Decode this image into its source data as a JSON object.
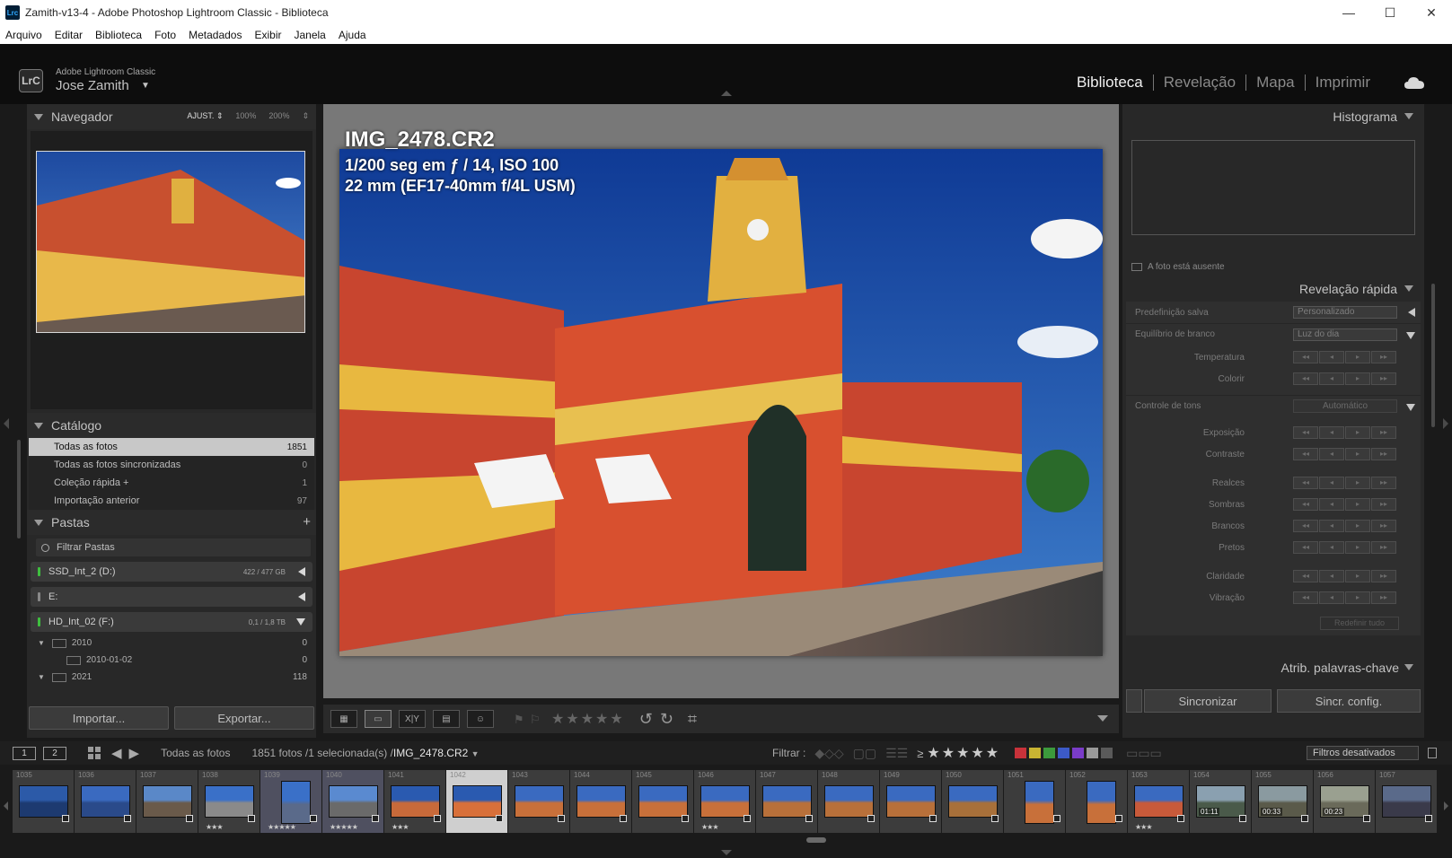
{
  "window": {
    "title": "Zamith-v13-4 - Adobe Photoshop Lightroom Classic - Biblioteca",
    "app_icon_text": "Lrc",
    "controls": [
      "—",
      "☐",
      "✕"
    ]
  },
  "menu": [
    "Arquivo",
    "Editar",
    "Biblioteca",
    "Foto",
    "Metadados",
    "Exibir",
    "Janela",
    "Ajuda"
  ],
  "identity": {
    "logo": "LrC",
    "product": "Adobe Lightroom Classic",
    "user": "Jose Zamith"
  },
  "modules": [
    {
      "label": "Biblioteca",
      "active": true
    },
    {
      "label": "Revelação",
      "active": false
    },
    {
      "label": "Mapa",
      "active": false
    },
    {
      "label": "Imprimir",
      "active": false
    }
  ],
  "navigator": {
    "title": "Navegador",
    "zoom": [
      "AJUST. ⇕",
      "100%",
      "200%",
      "⇕"
    ]
  },
  "catalog": {
    "title": "Catálogo",
    "items": [
      {
        "label": "Todas as fotos",
        "count": "1851",
        "selected": true
      },
      {
        "label": "Todas as fotos sincronizadas",
        "count": "0",
        "selected": false
      },
      {
        "label": "Coleção rápida  +",
        "count": "1",
        "selected": false
      },
      {
        "label": "Importação anterior",
        "count": "97",
        "selected": false
      }
    ]
  },
  "folders": {
    "title": "Pastas",
    "add": "+",
    "filter_placeholder": "Filtrar Pastas",
    "volumes": [
      {
        "name": "SSD_Int_2 (D:)",
        "info": "422 / 477 GB",
        "led": "green"
      },
      {
        "name": "E:",
        "info": "",
        "led": "gray"
      },
      {
        "name": "HD_Int_02 (F:)",
        "info": "0,1 / 1,8 TB",
        "led": "green"
      }
    ],
    "tree": [
      {
        "label": "2010",
        "count": "0"
      },
      {
        "label": "2010-01-02",
        "count": "0"
      },
      {
        "label": "2021",
        "count": "118"
      }
    ]
  },
  "left_buttons": {
    "import": "Importar...",
    "export": "Exportar..."
  },
  "loupe": {
    "filename": "IMG_2478.CR2",
    "exif1": "1/200 seg em ƒ / 14, ISO 100",
    "exif2": "22 mm (EF17-40mm f/4L USM)"
  },
  "histogram": {
    "title": "Histograma",
    "message": "A foto está ausente"
  },
  "quick_develop": {
    "title": "Revelação rápida",
    "saved_preset_label": "Predefinição salva",
    "saved_preset_value": "Personalizado",
    "wb_label": "Equilíbrio de branco",
    "wb_value": "Luz do dia",
    "temperature": "Temperatura",
    "tint": "Colorir",
    "tone_label": "Controle de tons",
    "auto": "Automático",
    "exposure": "Exposição",
    "contrast": "Contraste",
    "highlights": "Realces",
    "shadows": "Sombras",
    "whites": "Brancos",
    "blacks": "Pretos",
    "clarity": "Claridade",
    "vibrance": "Vibração",
    "reset_all": "Redefinir tudo",
    "stepper": [
      "◂◂",
      "◂",
      "▸",
      "▸▸"
    ]
  },
  "keywords": {
    "title": "Atrib. palavras-chave"
  },
  "sync": {
    "sync": "Sincronizar",
    "sync_settings": "Sincr. config."
  },
  "toolbar": {
    "grid_icon": "grid-view-icon",
    "stars": "★★★★★"
  },
  "filmstrip_header": {
    "monitor1": "1",
    "monitor2": "2",
    "source": "Todas as fotos",
    "count": "1851 fotos /1 selecionada(s) /",
    "current_file": "IMG_2478.CR2",
    "filter_label": "Filtrar :",
    "stars_prefix": "≥",
    "stars": "★★★★★",
    "filters_off": "Filtros desativados",
    "swatches": [
      "#c8323a",
      "#c8b432",
      "#3c9a3c",
      "#3c5ac8",
      "#7a3cc8",
      "#9a9a9a",
      "#5a5a5a"
    ]
  },
  "filmstrip": [
    {
      "num": "1035",
      "stars": "",
      "c1": "#2c5aa8",
      "c2": "#1d3a70",
      "kind": "land"
    },
    {
      "num": "1036",
      "stars": "",
      "c1": "#3a6ac0",
      "c2": "#2a4a8a",
      "kind": "land"
    },
    {
      "num": "1037",
      "stars": "",
      "c1": "#5a88c8",
      "c2": "#6a5a4a",
      "kind": "land"
    },
    {
      "num": "1038",
      "stars": "★★★",
      "c1": "#3a70c8",
      "c2": "#8a8a8a",
      "kind": "land"
    },
    {
      "num": "1039",
      "stars": "★★★★★",
      "c1": "#3a70c8",
      "c2": "#5a6a8a",
      "kind": "port",
      "picked": true
    },
    {
      "num": "1040",
      "stars": "★★★★★",
      "c1": "#5a8ad0",
      "c2": "#6a6a6a",
      "kind": "land",
      "picked": true
    },
    {
      "num": "1041",
      "stars": "★★★",
      "c1": "#2a5ab0",
      "c2": "#c86a3a",
      "kind": "land"
    },
    {
      "num": "1042",
      "stars": "",
      "c1": "#2a5ab0",
      "c2": "#d8703a",
      "kind": "land",
      "selected": true
    },
    {
      "num": "1043",
      "stars": "",
      "c1": "#3a6ac0",
      "c2": "#c8703a",
      "kind": "land"
    },
    {
      "num": "1044",
      "stars": "",
      "c1": "#3a6ac0",
      "c2": "#c8703a",
      "kind": "land"
    },
    {
      "num": "1045",
      "stars": "",
      "c1": "#3a6ac0",
      "c2": "#c8703a",
      "kind": "land"
    },
    {
      "num": "1046",
      "stars": "★★★",
      "c1": "#3a6ac0",
      "c2": "#c8703a",
      "kind": "land"
    },
    {
      "num": "1047",
      "stars": "",
      "c1": "#3a6ac0",
      "c2": "#b8703a",
      "kind": "land"
    },
    {
      "num": "1048",
      "stars": "",
      "c1": "#3a6ac0",
      "c2": "#b8703a",
      "kind": "land"
    },
    {
      "num": "1049",
      "stars": "",
      "c1": "#3a6ac0",
      "c2": "#b8703a",
      "kind": "land"
    },
    {
      "num": "1050",
      "stars": "",
      "c1": "#3a6ac0",
      "c2": "#a8703a",
      "kind": "land"
    },
    {
      "num": "1051",
      "stars": "",
      "c1": "#3a6ac0",
      "c2": "#c8703a",
      "kind": "port"
    },
    {
      "num": "1052",
      "stars": "",
      "c1": "#3a6ac0",
      "c2": "#c8703a",
      "kind": "port"
    },
    {
      "num": "1053",
      "stars": "★★★",
      "c1": "#3a6ac0",
      "c2": "#c85a3a",
      "kind": "land"
    },
    {
      "num": "1054",
      "stars": "",
      "c1": "#8aa0b0",
      "c2": "#4a5a4a",
      "kind": "land",
      "duration": "01:11"
    },
    {
      "num": "1055",
      "stars": "",
      "c1": "#8a9aa0",
      "c2": "#5a5a4a",
      "kind": "land",
      "duration": "00:33"
    },
    {
      "num": "1056",
      "stars": "",
      "c1": "#9aa090",
      "c2": "#6a6a5a",
      "kind": "land",
      "duration": "00:23"
    },
    {
      "num": "1057",
      "stars": "",
      "c1": "#5a6a8a",
      "c2": "#3a3a4a",
      "kind": "land"
    }
  ]
}
